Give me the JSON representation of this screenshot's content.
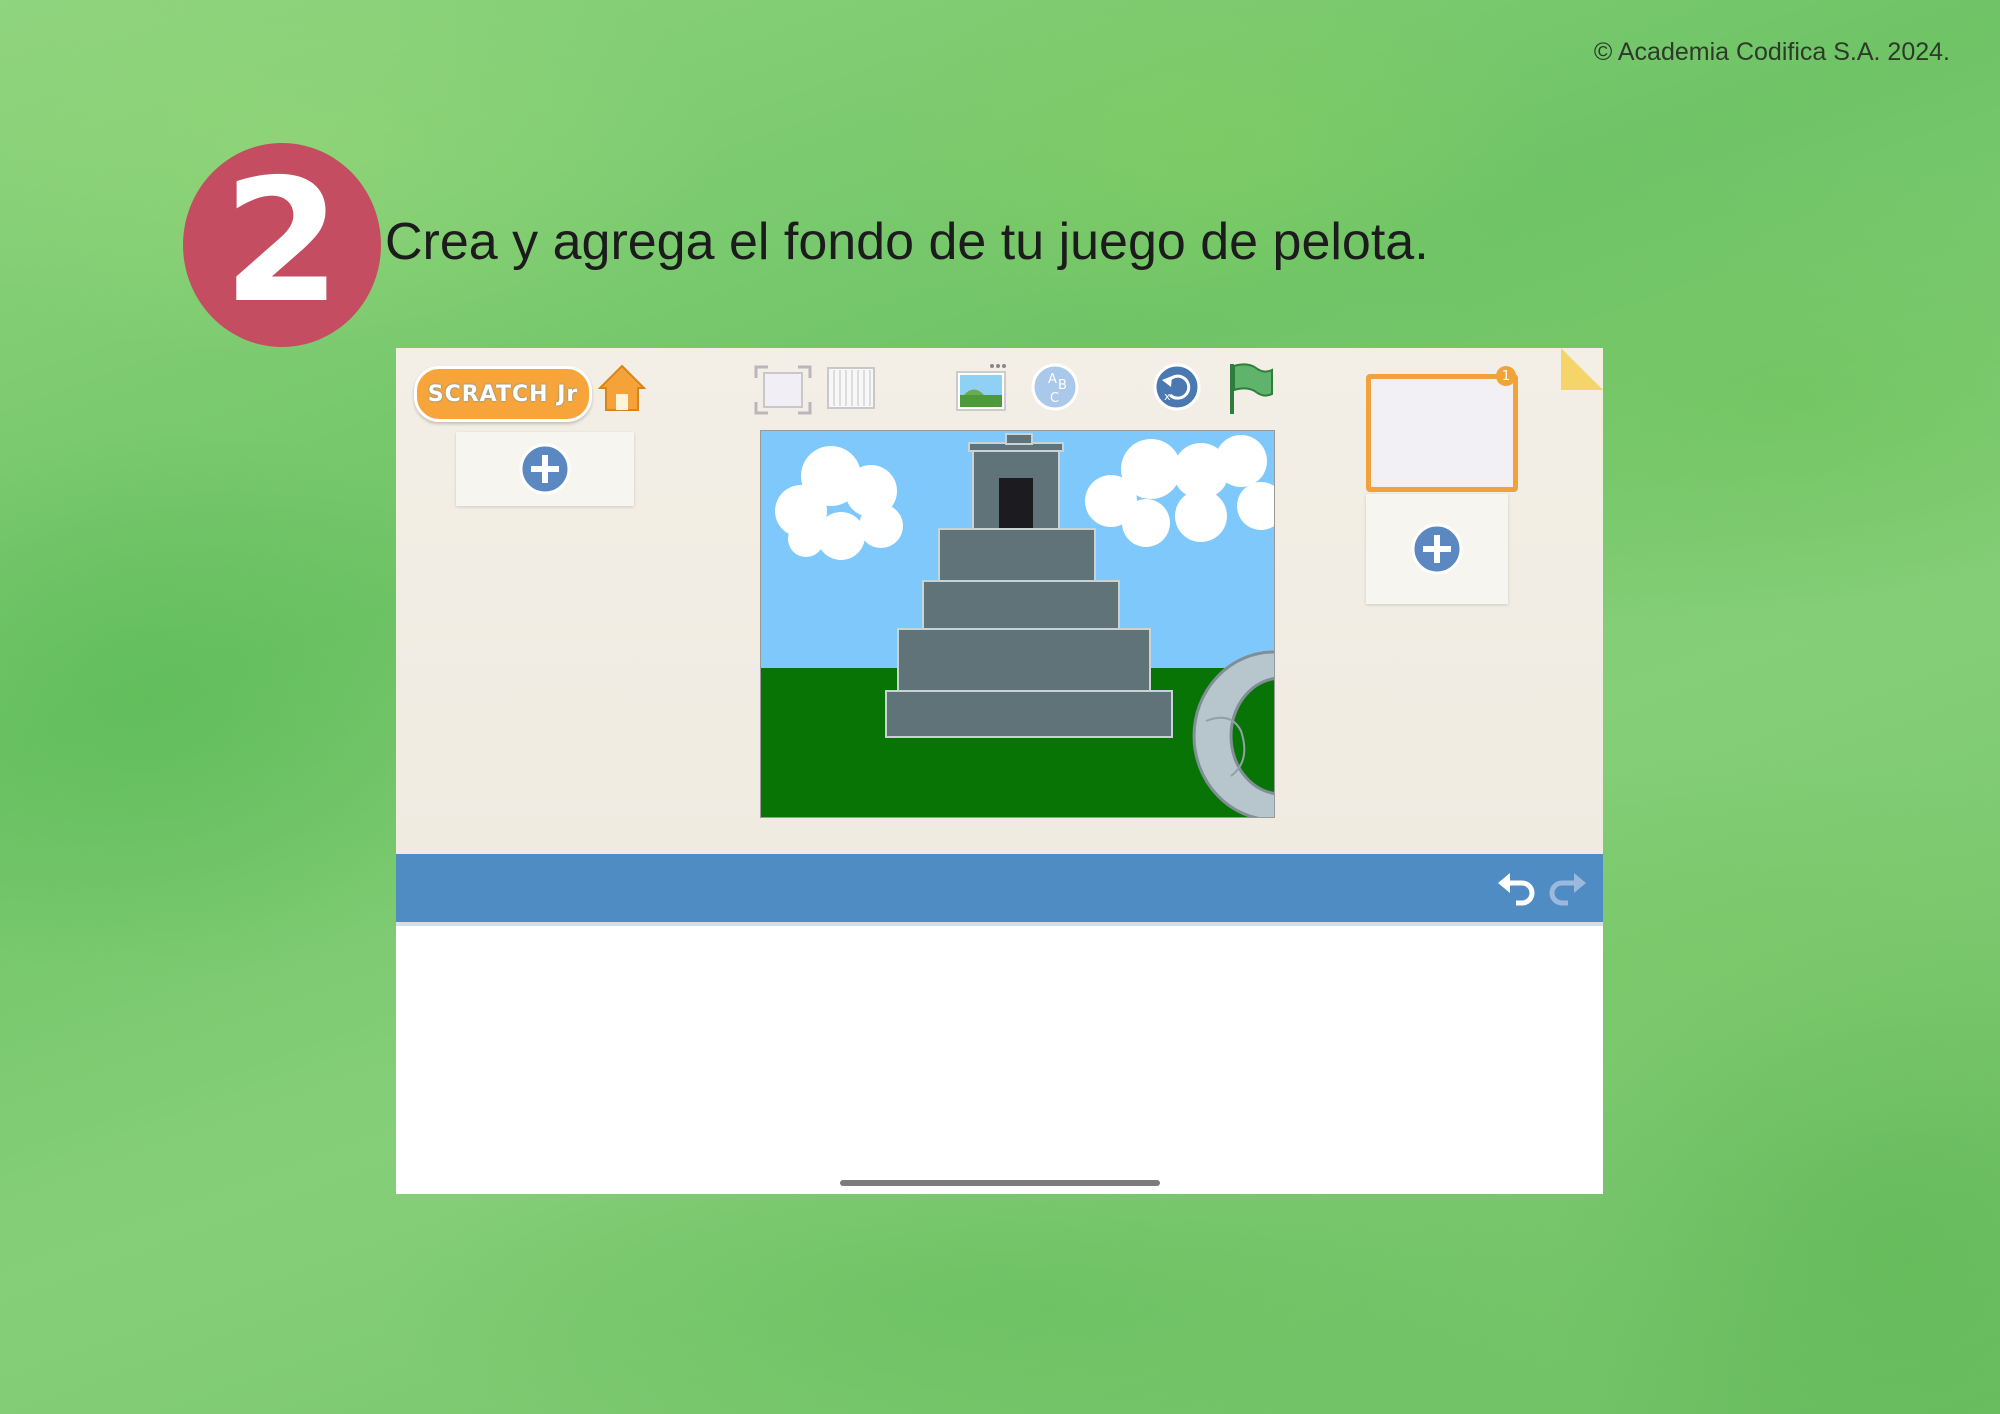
{
  "copyright": "© Academia Codifica S.A. 2024.",
  "step": {
    "number": "2",
    "instruction": "Crea y agrega el fondo de tu juego de pelota."
  },
  "app": {
    "logo_text": "SCRATCH Jr",
    "page_number": "1",
    "colors": {
      "accent_orange": "#f1a23c",
      "toolbar_blue": "#4f8cc4",
      "sky": "#7ec8fb",
      "grass": "#087406",
      "stone": "#5f7379"
    },
    "icons": {
      "home": "home-icon",
      "fullscreen": "fullscreen-icon",
      "grid": "grid-icon",
      "background": "background-icon",
      "text": "text-abc-icon",
      "reset": "reset-icon",
      "green_flag": "green-flag-icon",
      "add_character": "plus-icon",
      "add_page": "plus-icon",
      "undo": "undo-icon",
      "redo": "redo-icon"
    }
  }
}
